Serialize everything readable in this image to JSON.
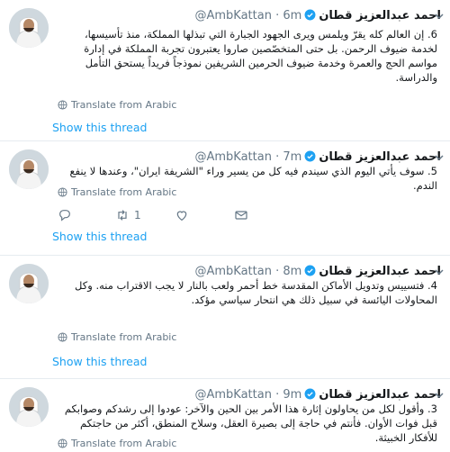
{
  "tweets": [
    {
      "name": "احمد عبدالعزيز قطان",
      "handle": "@AmbKattan",
      "sep": "·",
      "time": "6m",
      "text": "6. إن العالم كله يقرّ ويلمس ويرى الجهود الجبارة التي تبذلها المملكة، منذ تأسيسها، لخدمة ضيوف الرحمن. بل حتى المتخصّصين صاروا يعتبرون تجربة المملكة في إدارة مواسم الحج والعمرة وخدمة ضيوف الحرمين الشريفين نموذجاً فريداً يستحق التأمل والدراسة.",
      "translate": "Translate from Arabic",
      "show_thread": "Show this thread"
    },
    {
      "name": "احمد عبدالعزيز قطان",
      "handle": "@AmbKattan",
      "sep": "·",
      "time": "7m",
      "text": "5. سوف يأتي اليوم الذي سيندم فيه كل من يسير وراء \"الشريفة ايران\"، وعندها لا ينفع الندم.",
      "translate": "Translate from Arabic",
      "retweets": "1",
      "show_thread": "Show this thread"
    },
    {
      "name": "احمد عبدالعزيز قطان",
      "handle": "@AmbKattan",
      "sep": "·",
      "time": "8m",
      "text": "4. فتسييس وتدويل الأماكن المقدسة خط أحمر ولعب بالنار لا يجب الاقتراب منه. وكل المحاولات اليائسة في سبيل ذلك هي انتحار سياسي مؤكد.",
      "translate": "Translate from Arabic",
      "show_thread": "Show this thread"
    },
    {
      "name": "احمد عبدالعزيز قطان",
      "handle": "@AmbKattan",
      "sep": "·",
      "time": "9m",
      "text": "3. وأقول لكل من يحاولون إثارة هذا الأمر بين الحين والآخر: عودوا إلى رشدكم وصوابكم قبل فوات الأوان. فأنتم في حاجة إلى بصيرة العقل، وسلاح المنطق، أكثر من حاجتكم للأفكار الخبيثة.",
      "translate": "Translate from Arabic"
    }
  ],
  "colors": {
    "link": "#1da1f2",
    "muted": "#657786",
    "text": "#14171a",
    "divider": "#e6ecf0"
  }
}
